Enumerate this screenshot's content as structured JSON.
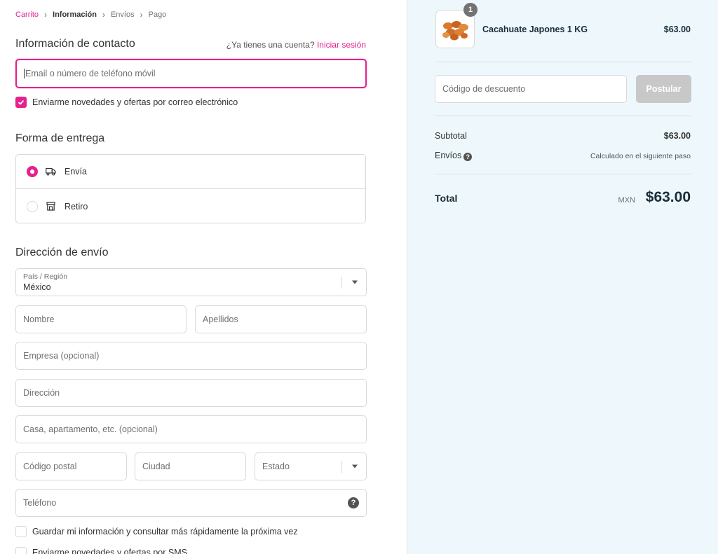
{
  "breadcrumb": {
    "cart": "Carrito",
    "information": "Información",
    "shipping": "Envíos",
    "payment": "Pago",
    "separator": "›"
  },
  "contact": {
    "title": "Información de contacto",
    "account_prompt": "¿Ya tienes una cuenta?",
    "login_link": "Iniciar sesión",
    "email_placeholder": "Email o número de teléfono móvil",
    "newsletter_label": "Enviarme novedades y ofertas por correo electrónico",
    "newsletter_checked": true
  },
  "delivery": {
    "title": "Forma de entrega",
    "options": [
      {
        "label": "Envía",
        "selected": true,
        "icon": "truck-icon"
      },
      {
        "label": "Retiro",
        "selected": false,
        "icon": "store-icon"
      }
    ]
  },
  "shipping_address": {
    "title": "Dirección de envío",
    "country_label": "País / Región",
    "country_value": "México",
    "first_name": "Nombre",
    "last_name": "Apellidos",
    "company": "Empresa (opcional)",
    "address": "Dirección",
    "apartment": "Casa, apartamento, etc. (opcional)",
    "postal_code": "Código postal",
    "city": "Ciudad",
    "state": "Estado",
    "phone": "Teléfono",
    "save_info": "Guardar mi información y consultar más rápidamente la próxima vez",
    "sms_offers": "Enviarme novedades y ofertas por SMS"
  },
  "summary": {
    "product_name": "Cacahuate Japones 1 KG",
    "product_price": "$63.00",
    "quantity": "1",
    "discount_placeholder": "Código de descuento",
    "apply_label": "Postular",
    "subtotal_label": "Subtotal",
    "subtotal_value": "$63.00",
    "shipping_label": "Envíos",
    "shipping_value": "Calculado en el siguiente paso",
    "total_label": "Total",
    "currency": "MXN",
    "total_value": "$63.00"
  },
  "colors": {
    "accent": "#e5208f",
    "summary_bg": "#eef8fc",
    "disabled_button": "#c8c8c8"
  }
}
